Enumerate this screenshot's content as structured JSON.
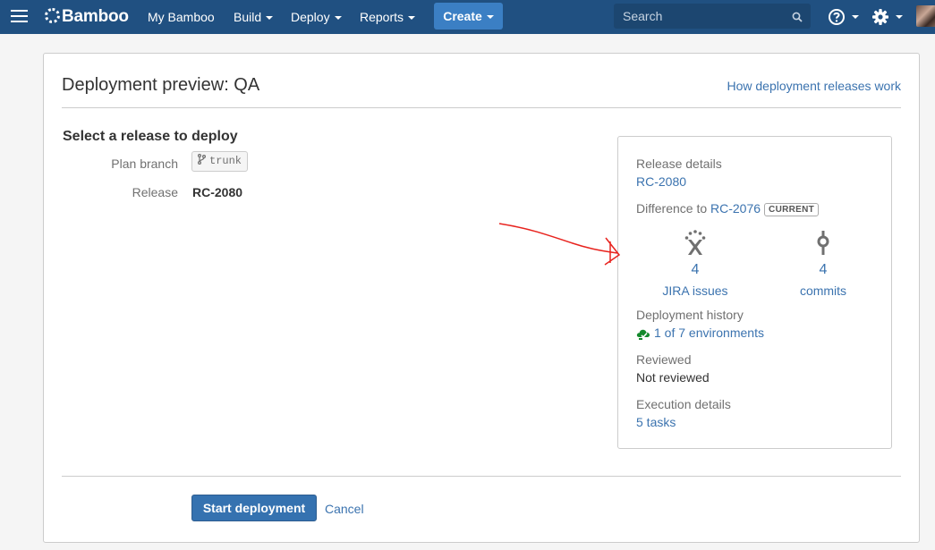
{
  "header": {
    "logo": "Bamboo",
    "nav": [
      {
        "label": "My Bamboo"
      },
      {
        "label": "Build"
      },
      {
        "label": "Deploy"
      },
      {
        "label": "Reports"
      }
    ],
    "create_label": "Create",
    "search_placeholder": "Search",
    "brand_color": "#205081"
  },
  "page": {
    "title": "Deployment preview: QA",
    "help_link": "How deployment releases work"
  },
  "form": {
    "section_heading": "Select a release to deploy",
    "plan_branch_label": "Plan branch",
    "plan_branch_value": "trunk",
    "release_label": "Release",
    "release_value": "RC-2080"
  },
  "details": {
    "release_details_label": "Release details",
    "release_link": "RC-2080",
    "difference_label": "Difference to",
    "difference_link": "RC-2076",
    "current_badge": "CURRENT",
    "jira": {
      "count": "4",
      "label": "JIRA issues"
    },
    "commits": {
      "count": "4",
      "label": "commits"
    },
    "deployment_history_label": "Deployment history",
    "deployment_history_link": "1 of 7 environments",
    "reviewed_label": "Reviewed",
    "reviewed_value": "Not reviewed",
    "execution_label": "Execution details",
    "execution_link": "5 tasks"
  },
  "actions": {
    "start_label": "Start deployment",
    "cancel_label": "Cancel"
  },
  "annotation_color": "#e8231e"
}
